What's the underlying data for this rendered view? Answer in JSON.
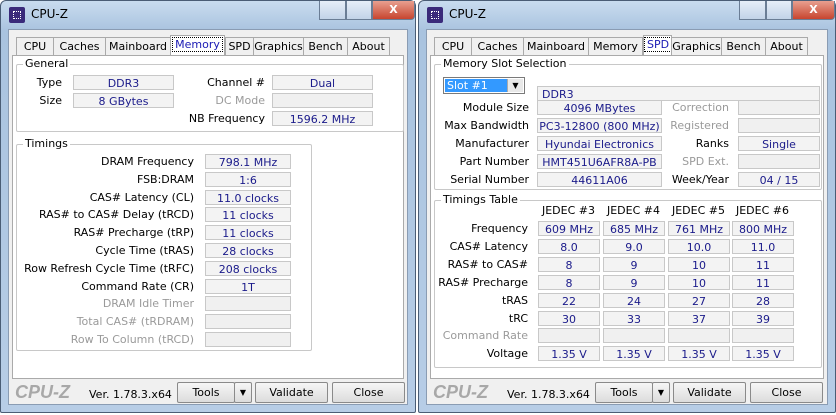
{
  "memory_window": {
    "title": "CPU-Z",
    "tabs": [
      "CPU",
      "Caches",
      "Mainboard",
      "Memory",
      "SPD",
      "Graphics",
      "Bench",
      "About"
    ],
    "active_tab": "Memory",
    "general": {
      "label": "General",
      "type_label": "Type",
      "type": "DDR3",
      "size_label": "Size",
      "size": "8 GBytes",
      "channel_label": "Channel #",
      "channel": "Dual",
      "dc_mode_label": "DC Mode",
      "dc_mode": "",
      "nb_freq_label": "NB Frequency",
      "nb_freq": "1596.2 MHz"
    },
    "timings": {
      "label": "Timings",
      "rows": [
        {
          "label": "DRAM Frequency",
          "value": "798.1 MHz",
          "enabled": true
        },
        {
          "label": "FSB:DRAM",
          "value": "1:6",
          "enabled": true
        },
        {
          "label": "CAS# Latency (CL)",
          "value": "11.0 clocks",
          "enabled": true
        },
        {
          "label": "RAS# to CAS# Delay (tRCD)",
          "value": "11 clocks",
          "enabled": true
        },
        {
          "label": "RAS# Precharge (tRP)",
          "value": "11 clocks",
          "enabled": true
        },
        {
          "label": "Cycle Time (tRAS)",
          "value": "28 clocks",
          "enabled": true
        },
        {
          "label": "Row Refresh Cycle Time (tRFC)",
          "value": "208 clocks",
          "enabled": true
        },
        {
          "label": "Command Rate (CR)",
          "value": "1T",
          "enabled": true
        },
        {
          "label": "DRAM Idle Timer",
          "value": "",
          "enabled": false
        },
        {
          "label": "Total CAS# (tRDRAM)",
          "value": "",
          "enabled": false
        },
        {
          "label": "Row To Column (tRCD)",
          "value": "",
          "enabled": false
        }
      ]
    }
  },
  "spd_window": {
    "title": "CPU-Z",
    "tabs": [
      "CPU",
      "Caches",
      "Mainboard",
      "Memory",
      "SPD",
      "Graphics",
      "Bench",
      "About"
    ],
    "active_tab": "SPD",
    "slot": {
      "label": "Memory Slot Selection",
      "selected": "Slot #1",
      "type": "DDR3",
      "left_rows": [
        {
          "label": "Module Size",
          "value": "4096 MBytes"
        },
        {
          "label": "Max Bandwidth",
          "value": "PC3-12800 (800 MHz)"
        },
        {
          "label": "Manufacturer",
          "value": "Hyundai Electronics"
        },
        {
          "label": "Part Number",
          "value": "HMT451U6AFR8A-PB"
        },
        {
          "label": "Serial Number",
          "value": "44611A06"
        }
      ],
      "right_rows": [
        {
          "label": "Correction",
          "value": "",
          "enabled": false
        },
        {
          "label": "Registered",
          "value": "",
          "enabled": false
        },
        {
          "label": "Ranks",
          "value": "Single",
          "enabled": true
        },
        {
          "label": "SPD Ext.",
          "value": "",
          "enabled": false
        },
        {
          "label": "Week/Year",
          "value": "04 / 15",
          "enabled": true
        }
      ]
    },
    "timings_table": {
      "label": "Timings Table",
      "headers": [
        "JEDEC #3",
        "JEDEC #4",
        "JEDEC #5",
        "JEDEC #6"
      ],
      "rows": [
        {
          "label": "Frequency",
          "values": [
            "609 MHz",
            "685 MHz",
            "761 MHz",
            "800 MHz"
          ],
          "enabled": true
        },
        {
          "label": "CAS# Latency",
          "values": [
            "8.0",
            "9.0",
            "10.0",
            "11.0"
          ],
          "enabled": true
        },
        {
          "label": "RAS# to CAS#",
          "values": [
            "8",
            "9",
            "10",
            "11"
          ],
          "enabled": true
        },
        {
          "label": "RAS# Precharge",
          "values": [
            "8",
            "9",
            "10",
            "11"
          ],
          "enabled": true
        },
        {
          "label": "tRAS",
          "values": [
            "22",
            "24",
            "27",
            "28"
          ],
          "enabled": true
        },
        {
          "label": "tRC",
          "values": [
            "30",
            "33",
            "37",
            "39"
          ],
          "enabled": true
        },
        {
          "label": "Command Rate",
          "values": [
            "",
            "",
            "",
            ""
          ],
          "enabled": false
        },
        {
          "label": "Voltage",
          "values": [
            "1.35 V",
            "1.35 V",
            "1.35 V",
            "1.35 V"
          ],
          "enabled": true
        }
      ]
    }
  },
  "footer": {
    "logo": "CPU-Z",
    "version": "Ver. 1.78.3.x64",
    "tools": "Tools",
    "dropdown": "▼",
    "validate": "Validate",
    "close": "Close"
  },
  "window_buttons": {
    "close": "X"
  }
}
